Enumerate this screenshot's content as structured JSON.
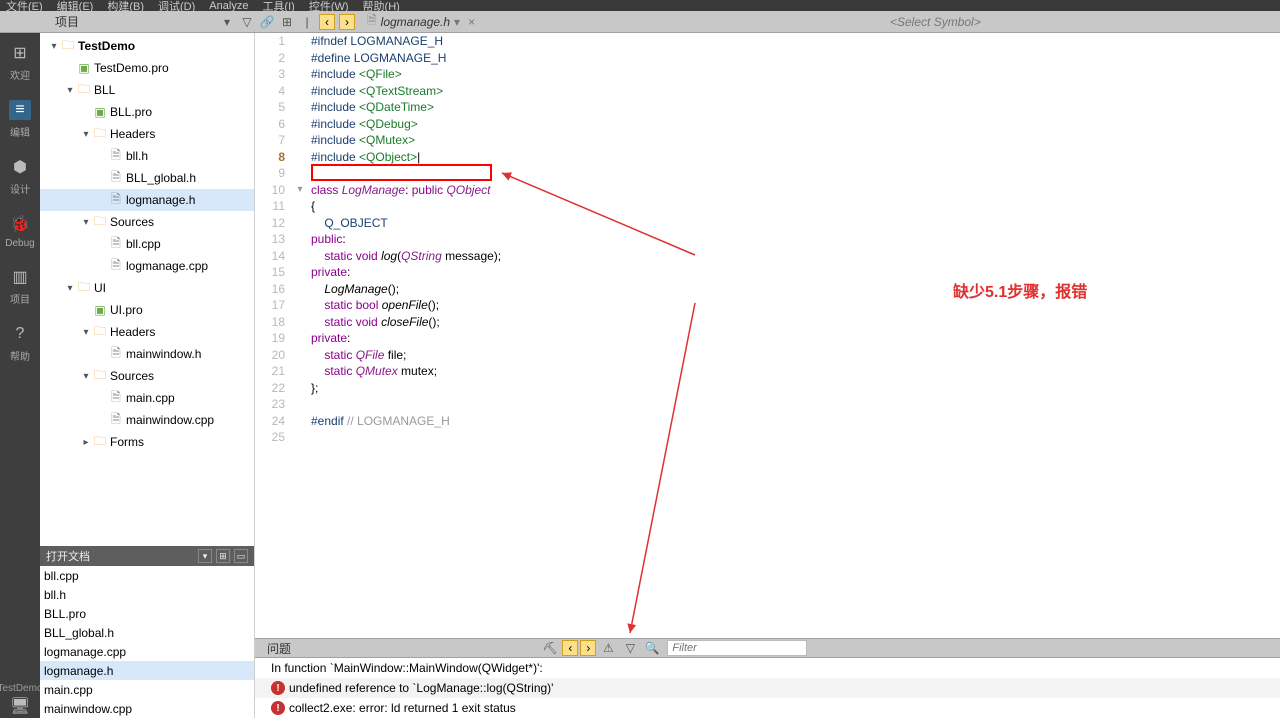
{
  "menu": [
    "文件(E)",
    "编辑(E)",
    "构建(B)",
    "调试(D)",
    "Analyze",
    "工具(I)",
    "控件(W)",
    "帮助(H)"
  ],
  "locator": {
    "left_label": "项目",
    "file_name": "logmanage.h",
    "symbol_placeholder": "<Select Symbol>"
  },
  "activity": [
    {
      "icon": "⊞",
      "label": "欢迎"
    },
    {
      "icon": "≡",
      "label": "编辑",
      "active": true
    },
    {
      "icon": "⬢",
      "label": "设计"
    },
    {
      "icon": "🐞",
      "label": "Debug"
    },
    {
      "icon": "▥",
      "label": "项目"
    },
    {
      "icon": "?",
      "label": "帮助"
    }
  ],
  "bottom_project": "TestDemo",
  "tree": [
    {
      "level": 0,
      "arrow": "▾",
      "icon": "folder",
      "label": "TestDemo",
      "bold": true
    },
    {
      "level": 1,
      "arrow": "",
      "icon": "pro",
      "label": "TestDemo.pro"
    },
    {
      "level": 1,
      "arrow": "▾",
      "icon": "folder",
      "label": "BLL"
    },
    {
      "level": 2,
      "arrow": "",
      "icon": "pro",
      "label": "BLL.pro"
    },
    {
      "level": 2,
      "arrow": "▾",
      "icon": "folder",
      "label": "Headers"
    },
    {
      "level": 3,
      "arrow": "",
      "icon": "file",
      "label": "bll.h"
    },
    {
      "level": 3,
      "arrow": "",
      "icon": "file",
      "label": "BLL_global.h"
    },
    {
      "level": 3,
      "arrow": "",
      "icon": "file",
      "label": "logmanage.h",
      "selected": true
    },
    {
      "level": 2,
      "arrow": "▾",
      "icon": "folder",
      "label": "Sources"
    },
    {
      "level": 3,
      "arrow": "",
      "icon": "file",
      "label": "bll.cpp"
    },
    {
      "level": 3,
      "arrow": "",
      "icon": "file",
      "label": "logmanage.cpp"
    },
    {
      "level": 1,
      "arrow": "▾",
      "icon": "folder",
      "label": "UI"
    },
    {
      "level": 2,
      "arrow": "",
      "icon": "pro",
      "label": "UI.pro"
    },
    {
      "level": 2,
      "arrow": "▾",
      "icon": "folder",
      "label": "Headers"
    },
    {
      "level": 3,
      "arrow": "",
      "icon": "file",
      "label": "mainwindow.h"
    },
    {
      "level": 2,
      "arrow": "▾",
      "icon": "folder",
      "label": "Sources"
    },
    {
      "level": 3,
      "arrow": "",
      "icon": "file",
      "label": "main.cpp"
    },
    {
      "level": 3,
      "arrow": "",
      "icon": "file",
      "label": "mainwindow.cpp"
    },
    {
      "level": 2,
      "arrow": "▸",
      "icon": "folder",
      "label": "Forms"
    }
  ],
  "open_docs": {
    "title": "打开文档",
    "files": [
      "bll.cpp",
      "bll.h",
      "BLL.pro",
      "BLL_global.h",
      "logmanage.cpp",
      "logmanage.h",
      "main.cpp",
      "mainwindow.cpp"
    ],
    "selected": "logmanage.h"
  },
  "code_lines": [
    {
      "n": 1,
      "fold": "",
      "html": "<span class='kw-pp'>#ifndef</span> <span class='macro'>LOGMANAGE_H</span>"
    },
    {
      "n": 2,
      "fold": "",
      "html": "<span class='kw-pp'>#define</span> <span class='macro'>LOGMANAGE_H</span>"
    },
    {
      "n": 3,
      "fold": "",
      "html": "<span class='kw-pp'>#include</span> <span class='kw-inc'>&lt;QFile&gt;</span>"
    },
    {
      "n": 4,
      "fold": "",
      "html": "<span class='kw-pp'>#include</span> <span class='kw-inc'>&lt;QTextStream&gt;</span>"
    },
    {
      "n": 5,
      "fold": "",
      "html": "<span class='kw-pp'>#include</span> <span class='kw-inc'>&lt;QDateTime&gt;</span>"
    },
    {
      "n": 6,
      "fold": "",
      "html": "<span class='kw-pp'>#include</span> <span class='kw-inc'>&lt;QDebug&gt;</span>"
    },
    {
      "n": 7,
      "fold": "",
      "html": "<span class='kw-pp'>#include</span> <span class='kw-inc'>&lt;QMutex&gt;</span>"
    },
    {
      "n": 8,
      "fold": "",
      "html": "<span class='kw-pp'>#include</span> <span class='kw-inc'>&lt;QObject&gt;</span>|",
      "current": true
    },
    {
      "n": 9,
      "fold": "",
      "html": ""
    },
    {
      "n": 10,
      "fold": "▾",
      "html": "<span class='kw-cls'>class</span> <span class='kw-obj'>LogManage</span>: <span class='kw-pub'>public</span> <span class='kw-obj'>QObject</span>"
    },
    {
      "n": 11,
      "fold": "",
      "html": "{"
    },
    {
      "n": 12,
      "fold": "",
      "html": "    <span class='macro'>Q_OBJECT</span>"
    },
    {
      "n": 13,
      "fold": "",
      "html": "<span class='kw-pub'>public</span>:"
    },
    {
      "n": 14,
      "fold": "",
      "html": "    <span class='kw-pub'>static</span> <span class='kw-type'>void</span> <span class='kw-fn'>log</span>(<span class='kw-obj'>QString</span> message);"
    },
    {
      "n": 15,
      "fold": "",
      "html": "<span class='kw-pub'>private</span>:"
    },
    {
      "n": 16,
      "fold": "",
      "html": "    <span class='kw-fn'>LogManage</span>();"
    },
    {
      "n": 17,
      "fold": "",
      "html": "    <span class='kw-pub'>static</span> <span class='kw-type'>bool</span> <span class='kw-fn'>openFile</span>();"
    },
    {
      "n": 18,
      "fold": "",
      "html": "    <span class='kw-pub'>static</span> <span class='kw-type'>void</span> <span class='kw-fn'>closeFile</span>();"
    },
    {
      "n": 19,
      "fold": "",
      "html": "<span class='kw-pub'>private</span>:"
    },
    {
      "n": 20,
      "fold": "",
      "html": "    <span class='kw-pub'>static</span> <span class='kw-obj'>QFile</span> file;"
    },
    {
      "n": 21,
      "fold": "",
      "html": "    <span class='kw-pub'>static</span> <span class='kw-obj'>QMutex</span> mutex;"
    },
    {
      "n": 22,
      "fold": "",
      "html": "};"
    },
    {
      "n": 23,
      "fold": "",
      "html": ""
    },
    {
      "n": 24,
      "fold": "",
      "html": "<span class='kw-pp'>#endif</span> <span class='kw-com'>// LOGMANAGE_H</span>"
    },
    {
      "n": 25,
      "fold": "",
      "html": ""
    }
  ],
  "output": {
    "tab": "问题",
    "filter_placeholder": "Filter",
    "rows": [
      {
        "type": "context",
        "text": "In function `MainWindow::MainWindow(QWidget*)':"
      },
      {
        "type": "error",
        "text": "undefined reference to `LogManage::log(QString)'",
        "highlight": true
      },
      {
        "type": "error",
        "text": "collect2.exe: error: ld returned 1 exit status"
      }
    ]
  },
  "annotation": "缺少5.1步骤，报错"
}
